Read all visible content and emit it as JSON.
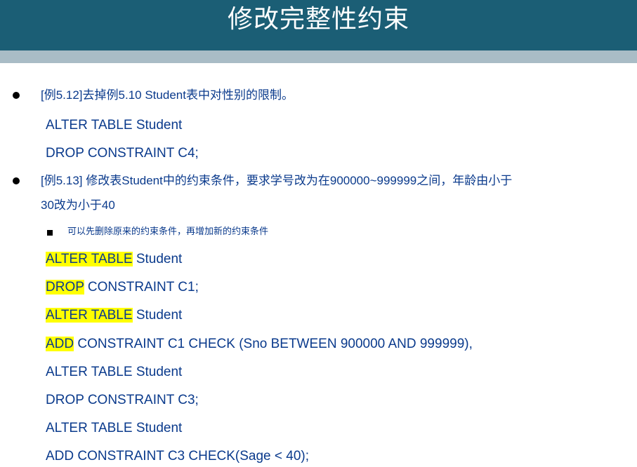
{
  "slide": {
    "title": "修改完整性约束"
  },
  "items": [
    {
      "bullet": "[例5.12]去掉例5.10 Student表中对性别的限制。",
      "code": [
        "ALTER TABLE Student",
        "DROP CONSTRAINT C4;"
      ]
    },
    {
      "bullet_line1": "[例5.13]  修改表Student中的约束条件，要求学号改为在900000~999999之间，年龄由小于",
      "bullet_line2": "30改为小于40",
      "sub_bullet": "可以先删除原来的约束条件，再增加新的约束条件",
      "code": [
        {
          "hl": "ALTER TABLE",
          "rest": " Student"
        },
        {
          "hl": "DROP",
          "rest": " CONSTRAINT C1;"
        },
        {
          "hl": "ALTER TABLE",
          "rest": " Student"
        },
        {
          "hl": "ADD",
          "rest": " CONSTRAINT C1 CHECK (Sno BETWEEN 900000 AND 999999),"
        },
        {
          "text": "ALTER TABLE Student"
        },
        {
          "text": "DROP CONSTRAINT C3;"
        },
        {
          "text": "ALTER TABLE Student"
        },
        {
          "text": "ADD CONSTRAINT C3 CHECK(Sage < 40);"
        }
      ]
    }
  ],
  "colors": {
    "title_bg": "#1b5e75",
    "stripe": "#a9bcc6",
    "text": "#0a3a8c",
    "highlight": "#ffff00"
  }
}
